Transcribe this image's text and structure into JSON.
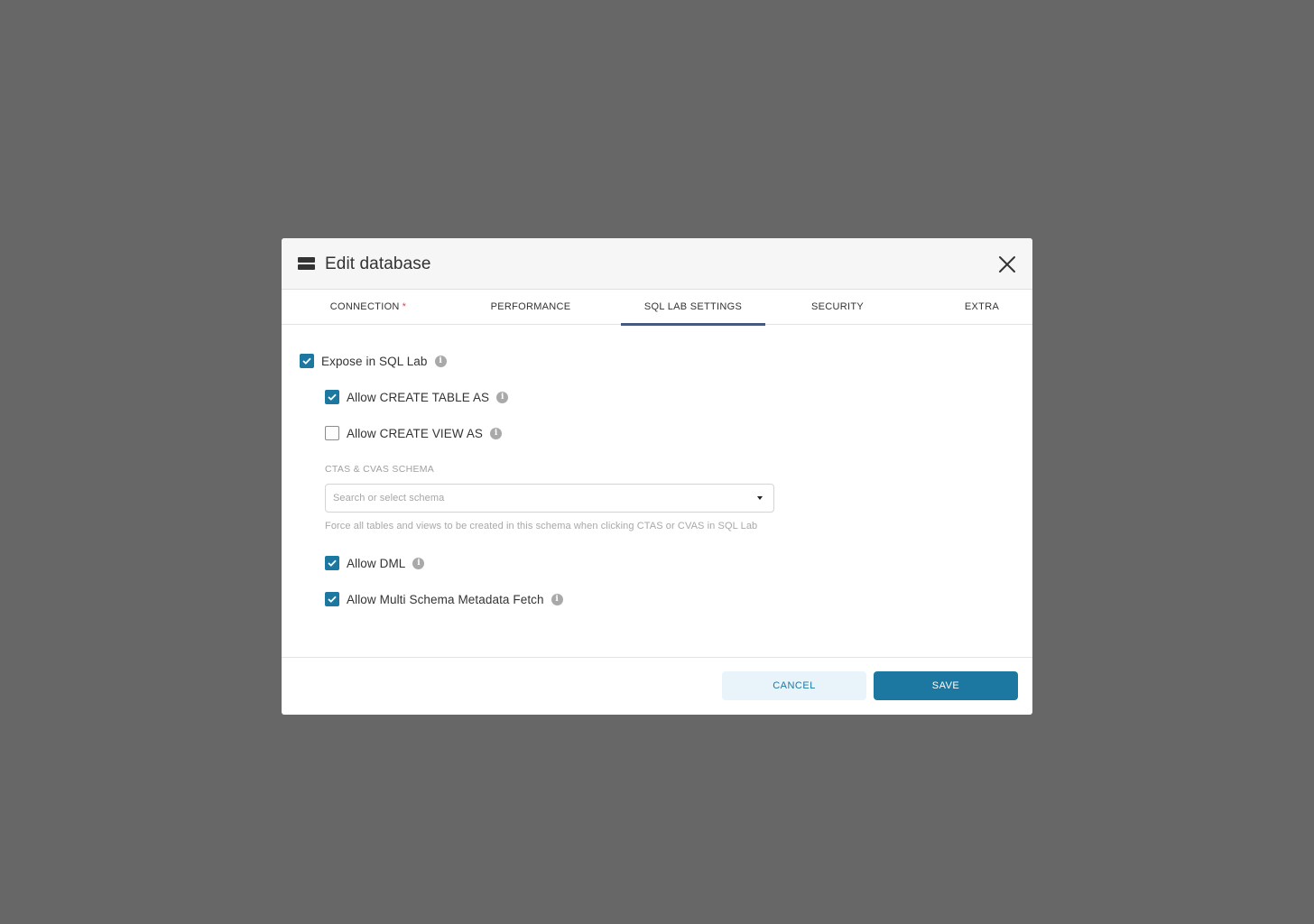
{
  "modal": {
    "title": "Edit database",
    "tabs": [
      {
        "label": "CONNECTION",
        "required": "*",
        "active": false
      },
      {
        "label": "PERFORMANCE",
        "active": false
      },
      {
        "label": "SQL LAB SETTINGS",
        "active": true
      },
      {
        "label": "SECURITY",
        "active": false
      },
      {
        "label": "EXTRA",
        "active": false
      }
    ]
  },
  "sql_lab": {
    "expose": {
      "label": "Expose in SQL Lab",
      "checked": true
    },
    "ctas": {
      "label": "Allow CREATE TABLE AS",
      "checked": true
    },
    "cvas": {
      "label": "Allow CREATE VIEW AS",
      "checked": false
    },
    "schema": {
      "label": "CTAS & CVAS SCHEMA",
      "placeholder": "Search or select schema",
      "helper": "Force all tables and views to be created in this schema when clicking CTAS or CVAS in SQL Lab"
    },
    "dml": {
      "label": "Allow DML",
      "checked": true
    },
    "multi_schema": {
      "label": "Allow Multi Schema Metadata Fetch",
      "checked": true
    }
  },
  "footer": {
    "cancel_label": "CANCEL",
    "save_label": "SAVE"
  },
  "colors": {
    "overlay": "#676767",
    "primary": "#1c78a0",
    "primary_light": "#e8f4f9",
    "tab_underline": "#46597e",
    "required": "#e04355"
  }
}
